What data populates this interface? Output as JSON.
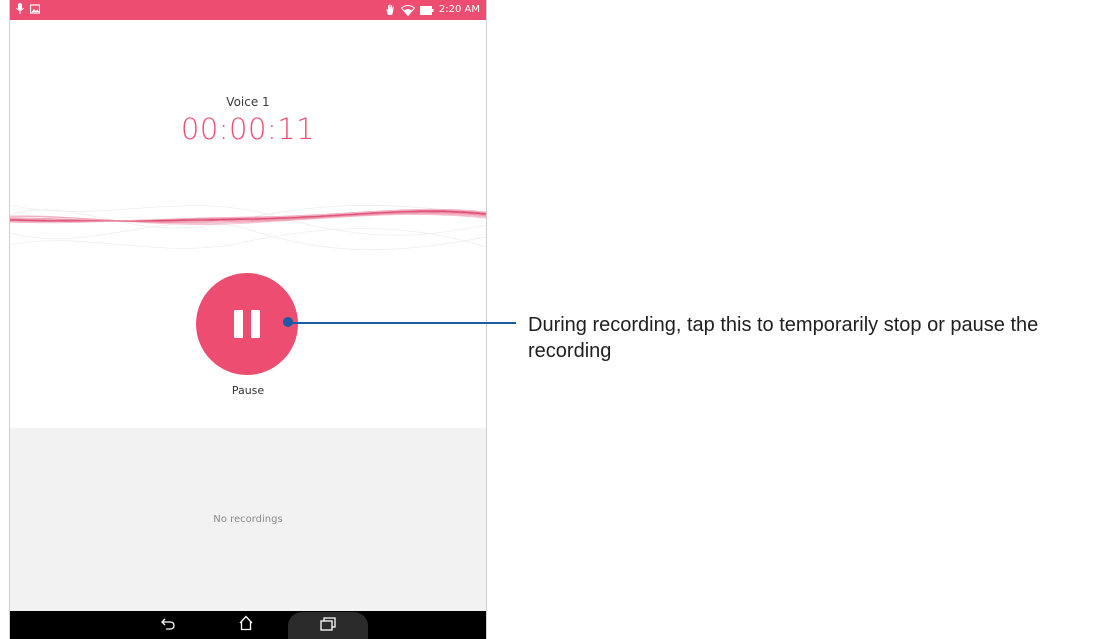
{
  "colors": {
    "accent": "#ee4d72",
    "callout": "#1a5ba6",
    "nav_bar": "#000000",
    "list_bg": "#f2f2f2"
  },
  "status_bar": {
    "left_icons": [
      "mic-icon",
      "image-icon"
    ],
    "right_icons": [
      "hand-icon",
      "wifi-icon",
      "battery-icon"
    ],
    "time": "2:20 AM"
  },
  "recorder": {
    "voice_name": "Voice 1",
    "elapsed": "00:00:11",
    "pause_label": "Pause",
    "pause_icon": "pause-icon"
  },
  "recordings": {
    "empty_text": "No recordings"
  },
  "nav": {
    "icons": [
      "back-icon",
      "home-icon",
      "recent-apps-icon"
    ]
  },
  "callout": {
    "text": "During recording, tap this to temporarily stop or pause the recording"
  }
}
